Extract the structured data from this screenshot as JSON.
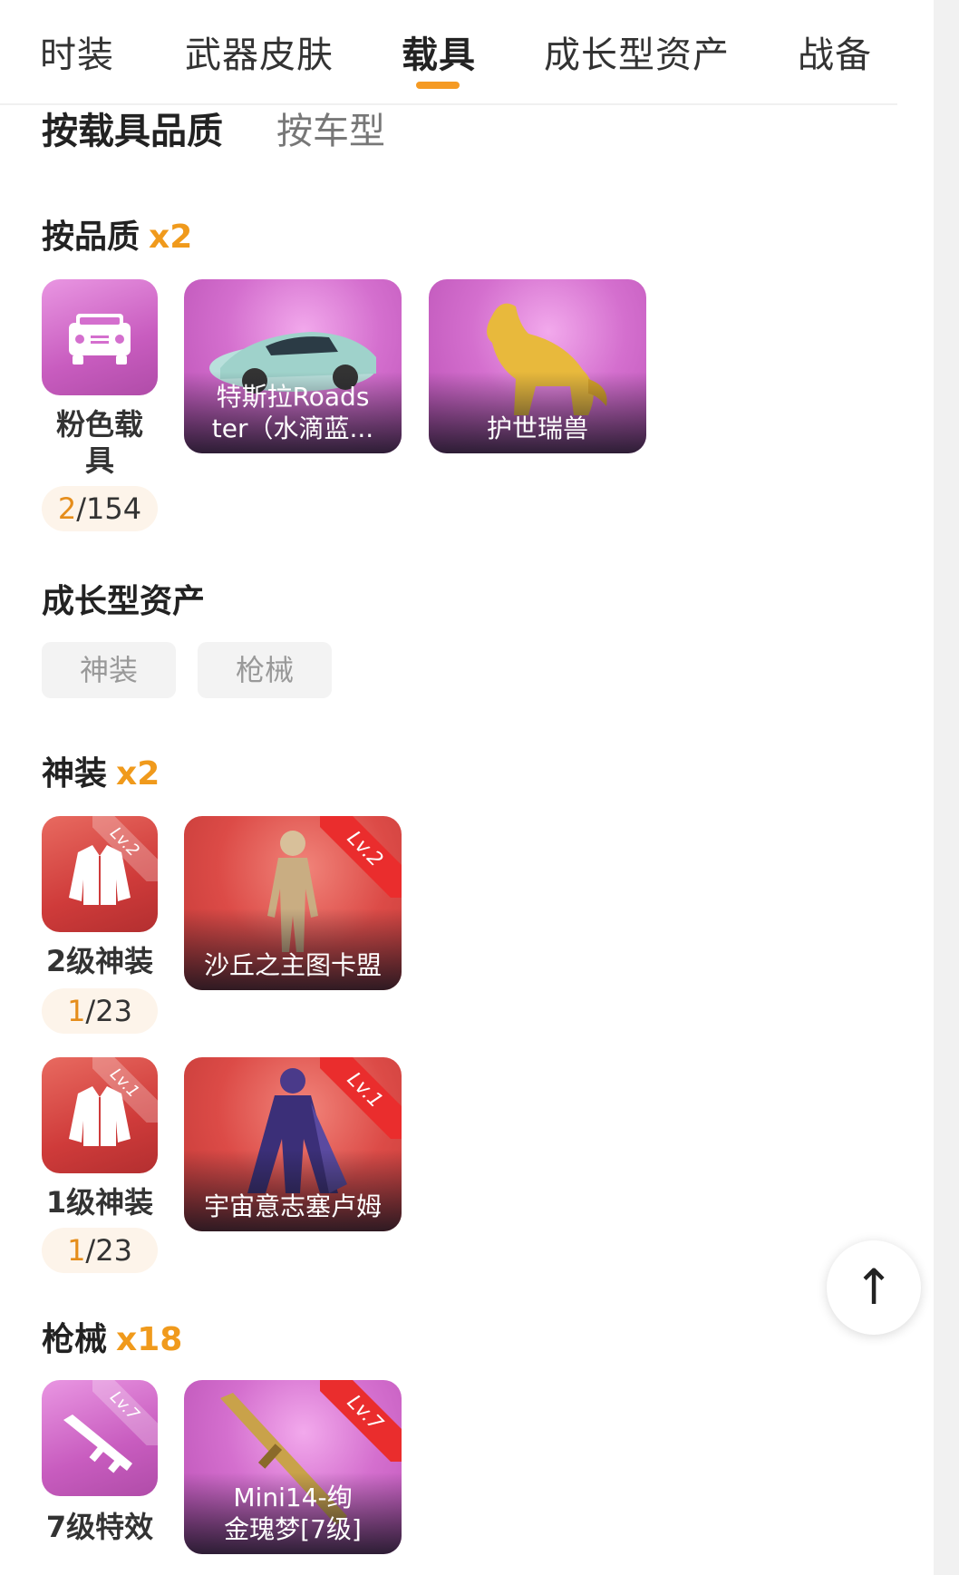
{
  "tabs": [
    {
      "label": "时装"
    },
    {
      "label": "武器皮肤"
    },
    {
      "label": "载具"
    },
    {
      "label": "成长型资产"
    },
    {
      "label": "战备"
    }
  ],
  "sub_tabs": [
    {
      "label": "按载具品质"
    },
    {
      "label": "按车型"
    }
  ],
  "quality_section": {
    "title": "按品质",
    "count": "x2",
    "category": {
      "name_line1": "粉色载",
      "name_line2": "具",
      "owned": "2",
      "total": "/154"
    },
    "items": [
      {
        "name_line1": "特斯拉Roads",
        "name_line2": "ter（水滴蓝..."
      },
      {
        "name": "护世瑞兽"
      }
    ]
  },
  "growth_section": {
    "title": "成长型资产",
    "chips": [
      "神装",
      "枪械"
    ]
  },
  "shenzhuang_section": {
    "title": "神装",
    "count": "x2",
    "groups": [
      {
        "category": {
          "name": "2级神装",
          "owned": "1",
          "total": "/23",
          "level": "Lv.2"
        },
        "item": {
          "name": "沙丘之主图卡盟",
          "level": "Lv.2"
        }
      },
      {
        "category": {
          "name": "1级神装",
          "owned": "1",
          "total": "/23",
          "level": "Lv.1"
        },
        "item": {
          "name": "宇宙意志塞卢姆",
          "level": "Lv.1"
        }
      }
    ]
  },
  "guns_section": {
    "title": "枪械",
    "count": "x18",
    "category": {
      "name": "7级特效",
      "level": "Lv.7"
    },
    "item": {
      "name_line1": "Mini14-绚",
      "name_line2": "金瑰梦[7级]",
      "level": "Lv.7"
    }
  },
  "back_to_top": {
    "icon": "arrow-up-icon",
    "glyph": "↑"
  },
  "colors": {
    "accent": "#f59a23",
    "count_orange": "#f09a1c",
    "pink": "#d46fce",
    "red": "#dc4b47"
  }
}
